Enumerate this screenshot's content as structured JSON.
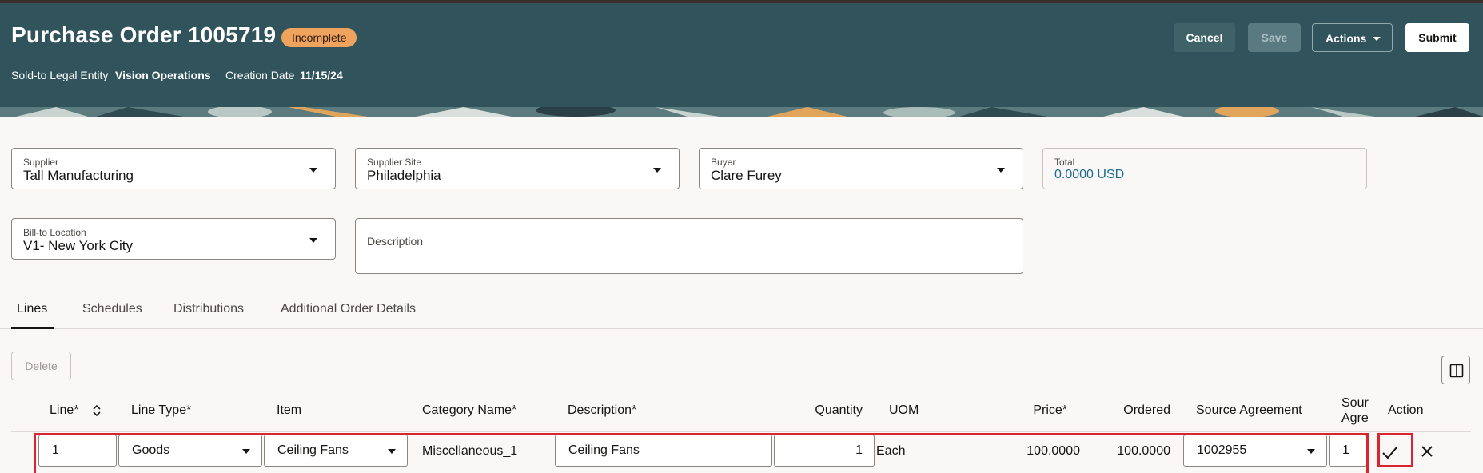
{
  "header": {
    "title": "Purchase Order 1005719",
    "status_badge": "Incomplete",
    "legal_entity_label": "Sold-to Legal Entity",
    "legal_entity_value": "Vision Operations",
    "creation_date_label": "Creation Date",
    "creation_date_value": "11/15/24",
    "buttons": {
      "cancel": "Cancel",
      "save": "Save",
      "actions": "Actions",
      "submit": "Submit"
    }
  },
  "form": {
    "supplier": {
      "label": "Supplier",
      "value": "Tall Manufacturing"
    },
    "supplier_site": {
      "label": "Supplier Site",
      "value": "Philadelphia"
    },
    "buyer": {
      "label": "Buyer",
      "value": "Clare Furey"
    },
    "total": {
      "label": "Total",
      "value": "0.0000 USD"
    },
    "bill_to": {
      "label": "Bill-to Location",
      "value": "V1- New York City"
    },
    "description": {
      "label": "Description",
      "value": ""
    }
  },
  "tabs": [
    "Lines",
    "Schedules",
    "Distributions",
    "Additional Order Details"
  ],
  "toolbar": {
    "delete_label": "Delete"
  },
  "table": {
    "columns": {
      "line": "Line*",
      "line_type": "Line Type*",
      "item": "Item",
      "category": "Category Name*",
      "description": "Description*",
      "quantity": "Quantity",
      "uom": "UOM",
      "price": "Price*",
      "ordered": "Ordered",
      "source_agreement": "Source Agreement",
      "source_agreement_line_1": "Sour",
      "source_agreement_line_2": "Agre",
      "action": "Action"
    },
    "row": {
      "line": "1",
      "line_type": "Goods",
      "item": "Ceiling Fans",
      "category": "Miscellaneous_1",
      "description": "Ceiling Fans",
      "quantity": "1",
      "uom": "Each",
      "price": "100.0000",
      "ordered": "100.0000",
      "source_agreement": "1002955",
      "source_agreement_line": "1"
    }
  },
  "colors": {
    "header_bg": "#31545c",
    "badge_bg": "#f0a35c",
    "highlight": "#d9252f",
    "link": "#1b6a8e"
  }
}
